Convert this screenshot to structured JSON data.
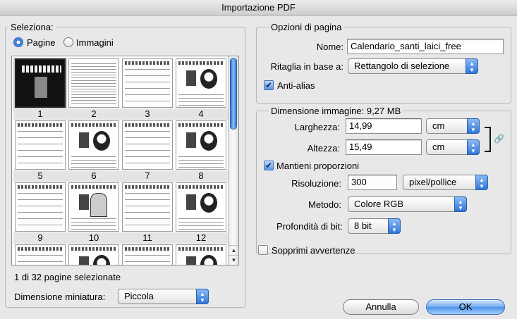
{
  "window": {
    "title": "Importazione PDF"
  },
  "select_group": {
    "title": "Seleziona:",
    "radio_pages": "Pagine",
    "radio_images": "Immagini",
    "selected_radio": "pages",
    "thumbnails": [
      {
        "label": "1",
        "selected": true,
        "style": "cover"
      },
      {
        "label": "2",
        "selected": false,
        "style": "text"
      },
      {
        "label": "3",
        "selected": false,
        "style": "calendar"
      },
      {
        "label": "4",
        "selected": false,
        "style": "caricature"
      },
      {
        "label": "5",
        "selected": false,
        "style": "calendar"
      },
      {
        "label": "6",
        "selected": false,
        "style": "caricature"
      },
      {
        "label": "7",
        "selected": false,
        "style": "calendar"
      },
      {
        "label": "8",
        "selected": false,
        "style": "caricature"
      },
      {
        "label": "9",
        "selected": false,
        "style": "calendar"
      },
      {
        "label": "10",
        "selected": false,
        "style": "tomb"
      },
      {
        "label": "11",
        "selected": false,
        "style": "calendar"
      },
      {
        "label": "12",
        "selected": false,
        "style": "caricature"
      },
      {
        "label": "",
        "selected": false,
        "style": "calendar"
      },
      {
        "label": "",
        "selected": false,
        "style": "caricature"
      },
      {
        "label": "",
        "selected": false,
        "style": "calendar"
      },
      {
        "label": "",
        "selected": false,
        "style": "caricature"
      }
    ],
    "status_text": "1 di 32 pagine selezionate",
    "thumb_size_label": "Dimensione miniatura:",
    "thumb_size_value": "Piccola"
  },
  "page_options": {
    "title": "Opzioni di pagina",
    "name_label": "Nome:",
    "name_value": "Calendario_santi_laici_free",
    "crop_label": "Ritaglia in base a:",
    "crop_value": "Rettangolo di selezione",
    "antialias_label": "Anti-alias",
    "antialias_checked": true
  },
  "image_size": {
    "title": "Dimensione immagine: 9,27 MB",
    "width_label": "Larghezza:",
    "width_value": "14,99",
    "width_unit": "cm",
    "height_label": "Altezza:",
    "height_value": "15,49",
    "height_unit": "cm",
    "constrain_label": "Mantieni proporzioni",
    "constrain_checked": true,
    "resolution_label": "Risoluzione:",
    "resolution_value": "300",
    "resolution_unit": "pixel/pollice",
    "mode_label": "Metodo:",
    "mode_value": "Colore RGB",
    "depth_label": "Profondità di bit:",
    "depth_value": "8 bit"
  },
  "suppress_warnings": {
    "label": "Sopprimi avvertenze",
    "checked": false
  },
  "buttons": {
    "cancel": "Annulla",
    "ok": "OK"
  },
  "icons": {
    "link": "chain-link-icon",
    "popup_arrows": "updown-arrows-icon",
    "check": "checkmark-icon"
  }
}
